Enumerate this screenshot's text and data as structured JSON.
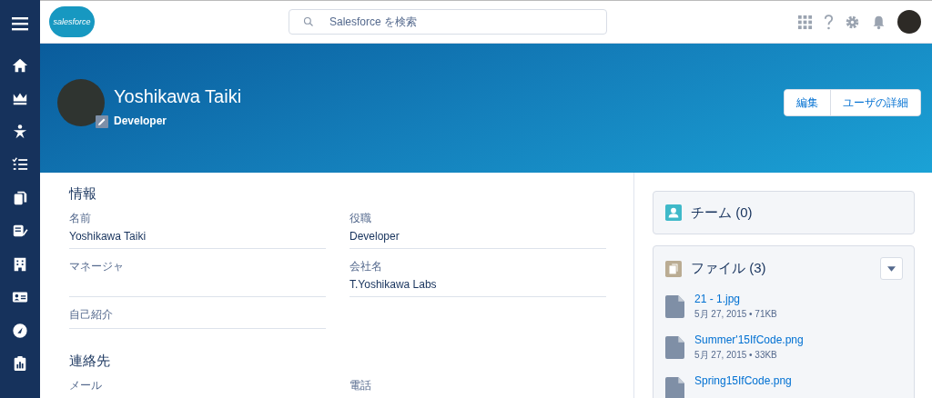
{
  "header": {
    "logo": "salesforce",
    "search": {
      "placeholder": "Salesforce を検索"
    }
  },
  "profile": {
    "name": "Yoshikawa Taiki",
    "title": "Developer",
    "buttons": [
      "編集",
      "ユーザの詳細"
    ]
  },
  "info": {
    "heading": "情報",
    "fields": [
      {
        "label": "名前",
        "value": "Yoshikawa Taiki"
      },
      {
        "label": "役職",
        "value": "Developer"
      },
      {
        "label": "マネージャ"
      },
      {
        "label": "会社名",
        "value": "T.Yoshikawa Labs"
      },
      {
        "label": "自己紹介"
      }
    ]
  },
  "contact": {
    "heading": "連絡先",
    "fields": [
      {
        "label": "メール"
      },
      {
        "label": "電話"
      }
    ]
  },
  "team": {
    "title": "チーム (0)"
  },
  "files": {
    "title": "ファイル (3)",
    "items": [
      {
        "name": "21 - 1.jpg",
        "meta": "5月 27, 2015 • 71KB"
      },
      {
        "name": "Summer'15IfCode.png",
        "meta": "5月 27, 2015 • 33KB"
      },
      {
        "name": "Spring15IfCode.png"
      }
    ]
  }
}
